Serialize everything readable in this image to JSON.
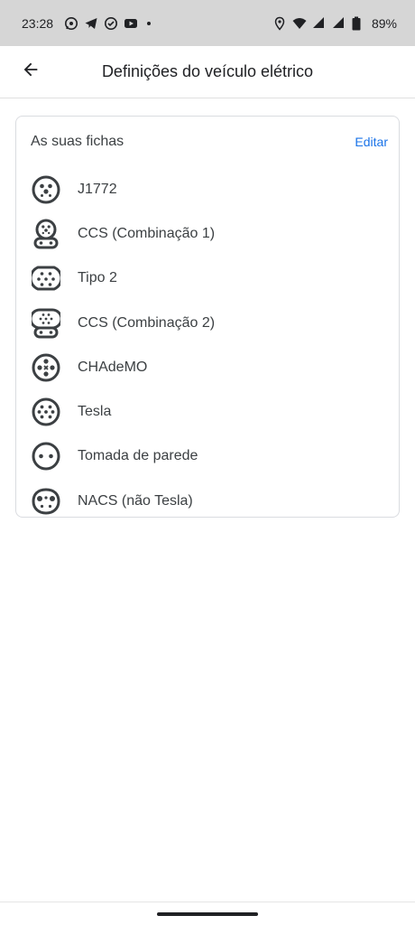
{
  "status_bar": {
    "time": "23:28",
    "left_icons": [
      "whatsapp-icon",
      "telegram-icon",
      "sync-icon",
      "youtube-icon"
    ],
    "right_icons": [
      "location-icon",
      "wifi-icon",
      "signal-icon",
      "signal-icon",
      "battery-icon"
    ],
    "battery": "89%"
  },
  "app_bar": {
    "back_icon": "arrow-back-icon",
    "title": "Definições do veículo elétrico"
  },
  "plugs_card": {
    "title": "As suas fichas",
    "edit_label": "Editar",
    "items": [
      {
        "label": "J1772",
        "icon": "j1772-plug-icon"
      },
      {
        "label": "CCS (Combinação 1)",
        "icon": "ccs1-plug-icon"
      },
      {
        "label": "Tipo 2",
        "icon": "type2-plug-icon"
      },
      {
        "label": "CCS (Combinação 2)",
        "icon": "ccs2-plug-icon"
      },
      {
        "label": "CHAdeMO",
        "icon": "chademo-plug-icon"
      },
      {
        "label": "Tesla",
        "icon": "tesla-plug-icon"
      },
      {
        "label": "Tomada de parede",
        "icon": "wall-outlet-icon"
      },
      {
        "label": "NACS (não Tesla)",
        "icon": "nacs-plug-icon"
      }
    ]
  },
  "colors": {
    "accent": "#1a73e8",
    "icon": "#3c4043",
    "status_bar_bg": "#d6d6d6"
  }
}
